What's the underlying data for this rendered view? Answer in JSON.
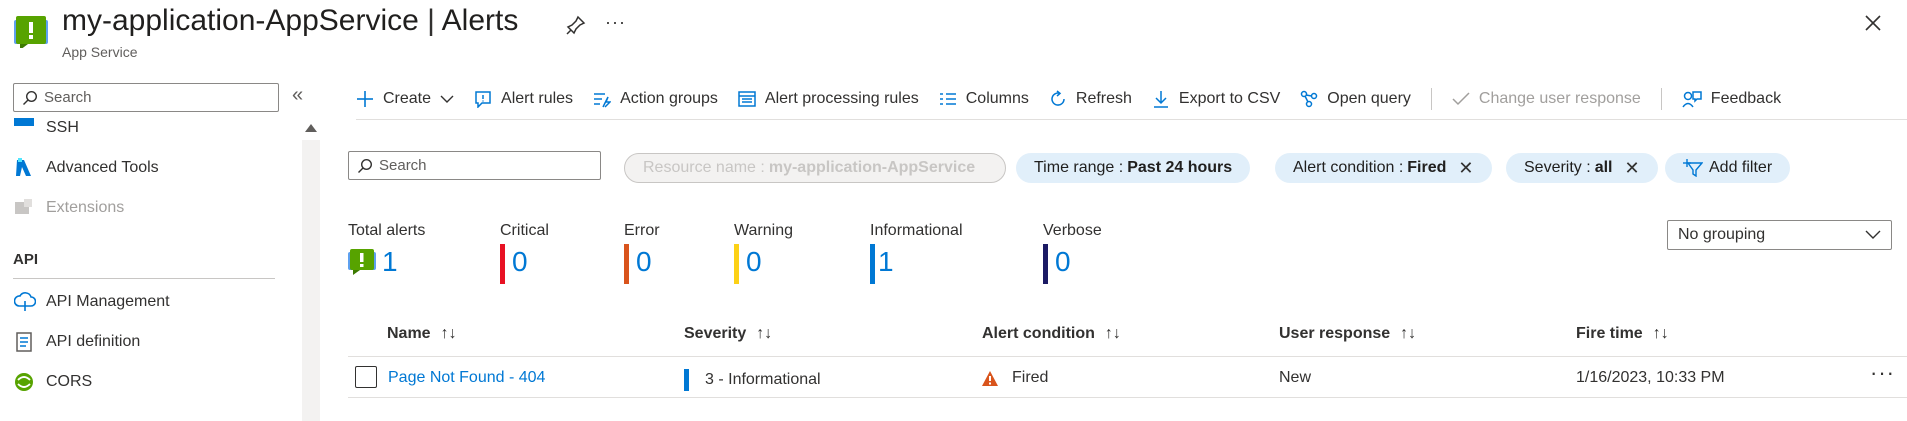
{
  "header": {
    "resource": "my-application-AppService",
    "separator": " | ",
    "blade": "Alerts",
    "subtitle": "App Service"
  },
  "sidebar": {
    "search_placeholder": "Search",
    "items": [
      {
        "label": "SSH",
        "icon": "ssh-icon"
      },
      {
        "label": "Advanced Tools",
        "icon": "advanced-tools-icon"
      },
      {
        "label": "Extensions",
        "icon": "extensions-icon",
        "disabled": true
      }
    ],
    "section": "API",
    "api_items": [
      {
        "label": "API Management",
        "icon": "api-management-icon"
      },
      {
        "label": "API definition",
        "icon": "api-definition-icon"
      },
      {
        "label": "CORS",
        "icon": "cors-icon"
      }
    ]
  },
  "toolbar": {
    "create": "Create",
    "alert_rules": "Alert rules",
    "action_groups": "Action groups",
    "alert_processing_rules": "Alert processing rules",
    "columns": "Columns",
    "refresh": "Refresh",
    "export_csv": "Export to CSV",
    "open_query": "Open query",
    "change_user_response": "Change user response",
    "feedback": "Feedback"
  },
  "filters": {
    "search_placeholder": "Search",
    "resource_name_key": "Resource name :",
    "resource_name_value": "my-application-AppService",
    "time_range_key": "Time range :",
    "time_range_value": "Past 24 hours",
    "alert_condition_key": "Alert condition :",
    "alert_condition_value": "Fired",
    "severity_key": "Severity :",
    "severity_value": "all",
    "add_filter": "Add filter"
  },
  "summary": {
    "total_label": "Total alerts",
    "total_value": "1",
    "critical_label": "Critical",
    "critical_value": "0",
    "error_label": "Error",
    "error_value": "0",
    "warning_label": "Warning",
    "warning_value": "0",
    "informational_label": "Informational",
    "informational_value": "1",
    "verbose_label": "Verbose",
    "verbose_value": "0",
    "colors": {
      "critical": "#e81123",
      "error": "#d9541c",
      "warning": "#fcd116",
      "informational": "#0078d4",
      "verbose": "#1b1a64"
    }
  },
  "grouping": {
    "selected": "No grouping"
  },
  "table": {
    "columns": [
      "Name",
      "Severity",
      "Alert condition",
      "User response",
      "Fire time"
    ],
    "rows": [
      {
        "name": "Page Not Found - 404",
        "severity": "3 - Informational",
        "alert_condition": "Fired",
        "user_response": "New",
        "fire_time": "1/16/2023, 10:33 PM"
      }
    ]
  }
}
